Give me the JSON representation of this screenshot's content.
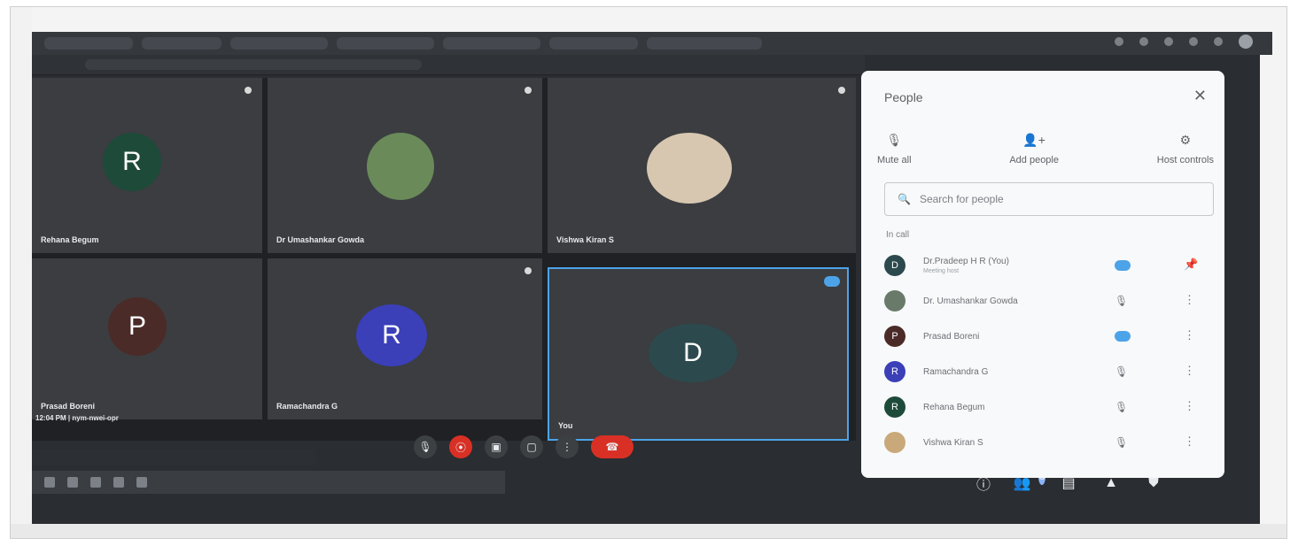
{
  "browser": {
    "tabs": [
      "",
      "",
      "",
      "",
      "",
      "",
      ""
    ]
  },
  "grid": {
    "tiles": [
      {
        "initial": "R",
        "name": "Rehana Begum",
        "color": "#1e4a3a"
      },
      {
        "initial": "",
        "name": "Dr Umashankar Gowda",
        "color": "#6a8a5a"
      },
      {
        "initial": "",
        "name": "Vishwa Kiran S",
        "color": "#d8c7b0"
      },
      {
        "initial": "P",
        "name": "Prasad Boreni",
        "color": "#4a2b28"
      },
      {
        "initial": "R",
        "name": "Ramachandra G",
        "color": "#3b3fb8"
      },
      {
        "initial": "D",
        "name": "You",
        "color": "#2c4a4d"
      }
    ],
    "meeting_info": "12:04 PM | nym-nwei-opr"
  },
  "controls": {
    "mic": "🎙",
    "cam": "⦿",
    "captions": "▣",
    "present": "▢",
    "more": "⋮",
    "end": "☎"
  },
  "bottom_icons": {
    "info": "ⓘ",
    "people": "👥",
    "people_count": "6",
    "chat": "▤",
    "activities": "▲",
    "host": "⛊"
  },
  "panel": {
    "title": "People",
    "close": "✕",
    "actions": [
      {
        "glyph": "🎙",
        "label": "Mute all"
      },
      {
        "glyph": "👤+",
        "label": "Add people"
      },
      {
        "glyph": "⚙",
        "label": "Host controls"
      }
    ],
    "search_placeholder": "Search for people",
    "search_icon": "🔍",
    "section_label": "In call",
    "people": [
      {
        "initial": "D",
        "name": "Dr.Pradeep H R (You)",
        "sub": "Meeting host",
        "color": "#2c4a4d",
        "status": "pill",
        "more": "📌"
      },
      {
        "initial": "",
        "name": "Dr. Umashankar Gowda",
        "sub": "",
        "color": "#6a7a6a",
        "status": "🎙",
        "more": "⋮"
      },
      {
        "initial": "P",
        "name": "Prasad Boreni",
        "sub": "",
        "color": "#4a2b28",
        "status": "pill",
        "more": "⋮"
      },
      {
        "initial": "R",
        "name": "Ramachandra G",
        "sub": "",
        "color": "#3b3fb8",
        "status": "🎙",
        "more": "⋮"
      },
      {
        "initial": "R",
        "name": "Rehana Begum",
        "sub": "",
        "color": "#1e4a3a",
        "status": "🎙",
        "more": "⋮"
      },
      {
        "initial": "",
        "name": "Vishwa Kiran S",
        "sub": "",
        "color": "#c9a97a",
        "status": "🎙",
        "more": "⋮"
      }
    ]
  }
}
